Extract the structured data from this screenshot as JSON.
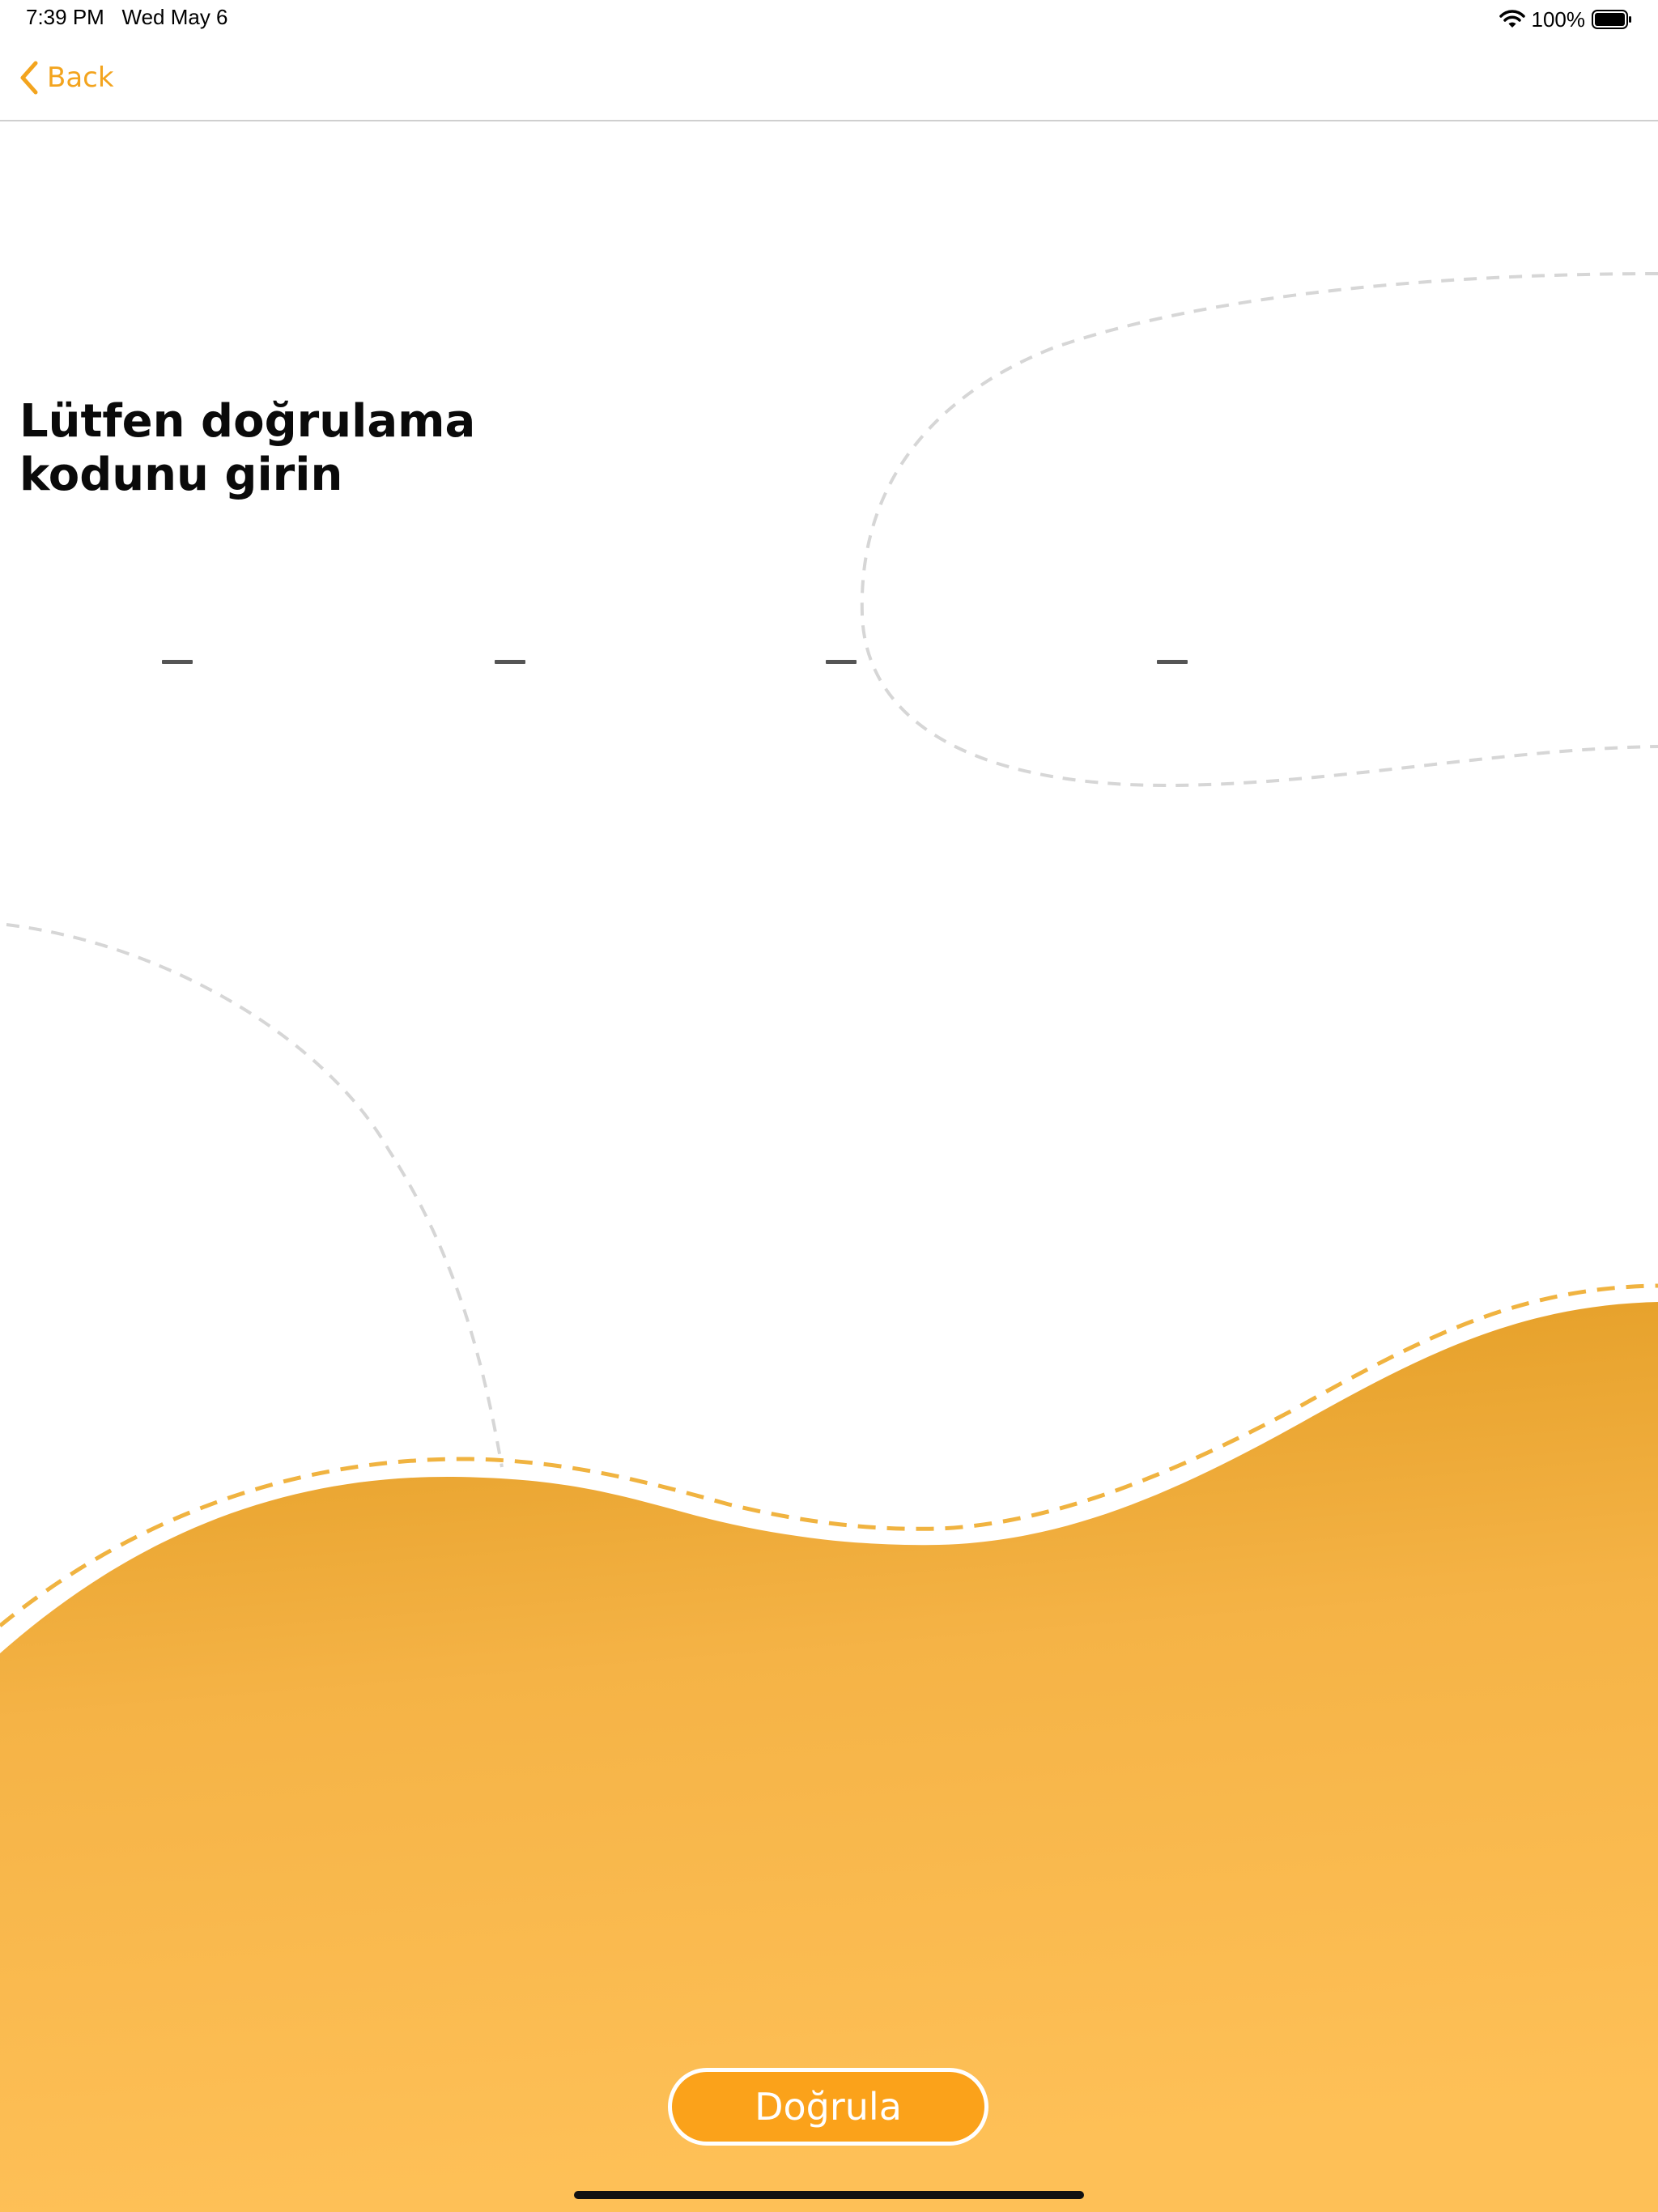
{
  "status_bar": {
    "time": "7:39 PM",
    "date": "Wed May 6",
    "battery_percent": "100%",
    "battery_level": 1.0,
    "icons": [
      "wifi-icon",
      "battery-icon"
    ]
  },
  "nav": {
    "back_label": "Back",
    "back_icon": "chevron-left-icon"
  },
  "title": {
    "line1": "Lütfen doğrulama",
    "line2": "kodunu girin"
  },
  "code_input": {
    "digit_count": 4,
    "values": [
      "",
      "",
      "",
      ""
    ]
  },
  "actions": {
    "verify_label": "Doğrula"
  },
  "colors": {
    "accent": "#f3a41e",
    "button_fill": "#fba21a",
    "wave_top": "#e19b22",
    "wave_bottom": "#fdbf55",
    "dashed_line_gray": "#d6d6d6",
    "dashed_line_orange": "#f0b340"
  }
}
